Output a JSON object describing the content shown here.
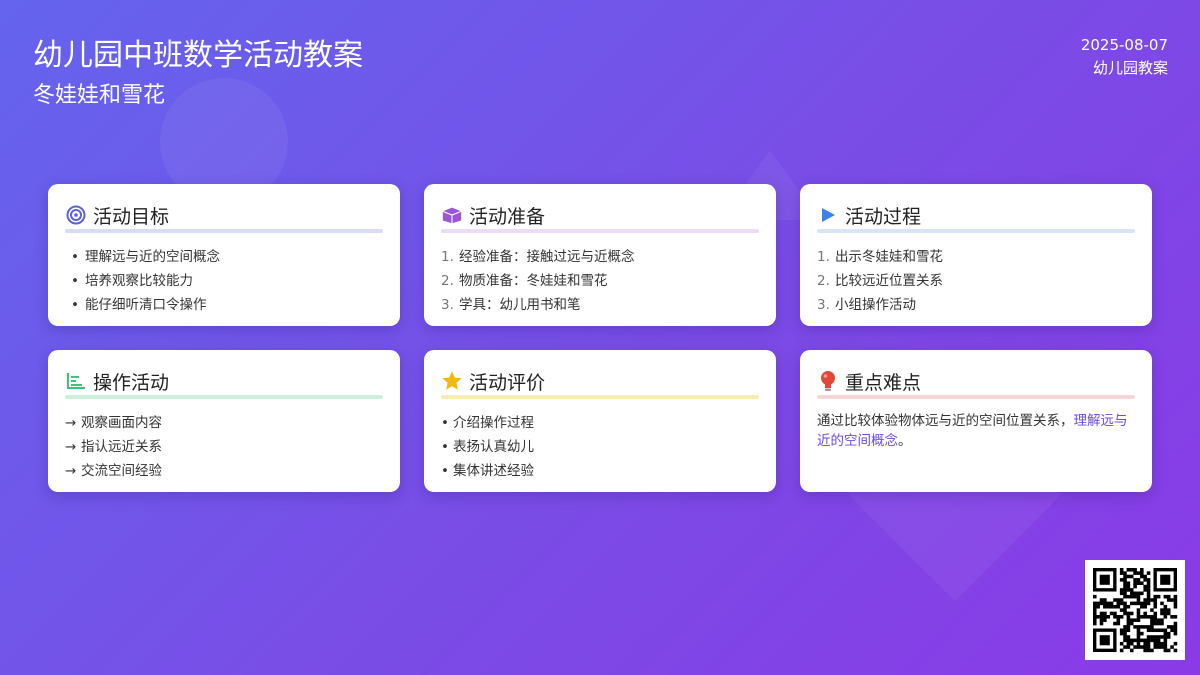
{
  "header": {
    "title": "幼儿园中班数学活动教案",
    "subtitle": "冬娃娃和雪花",
    "date": "2025-08-07",
    "doc_type": "幼儿园教案"
  },
  "cards": {
    "goals": {
      "title": "活动目标",
      "icon": "target-icon",
      "accent": "#5b64d8",
      "items": [
        "理解远与近的空间概念",
        "培养观察比较能力",
        "能仔细听清口令操作"
      ]
    },
    "prep": {
      "title": "活动准备",
      "icon": "box-icon",
      "accent": "#9b55d8",
      "items": [
        "经验准备：接触过远与近概念",
        "物质准备：冬娃娃和雪花",
        "学具：幼儿用书和笔"
      ]
    },
    "process": {
      "title": "活动过程",
      "icon": "play-icon",
      "accent": "#3b82e6",
      "items": [
        "出示冬娃娃和雪花",
        "比较远近位置关系",
        "小组操作活动"
      ]
    },
    "operation": {
      "title": "操作活动",
      "icon": "chart-icon",
      "accent": "#3cc47a",
      "items": [
        "观察画面内容",
        "指认远近关系",
        "交流空间经验"
      ]
    },
    "evaluation": {
      "title": "活动评价",
      "icon": "star-icon",
      "accent": "#f0b90b",
      "items": [
        "介绍操作过程",
        "表扬认真幼儿",
        "集体讲述经验"
      ]
    },
    "key": {
      "title": "重点难点",
      "icon": "lightbulb-icon",
      "accent": "#e0483a",
      "text_plain": "通过比较体验物体远与近的空间位置关系，",
      "text_highlight": "理解远与近的空间概念",
      "text_end": "。"
    }
  }
}
